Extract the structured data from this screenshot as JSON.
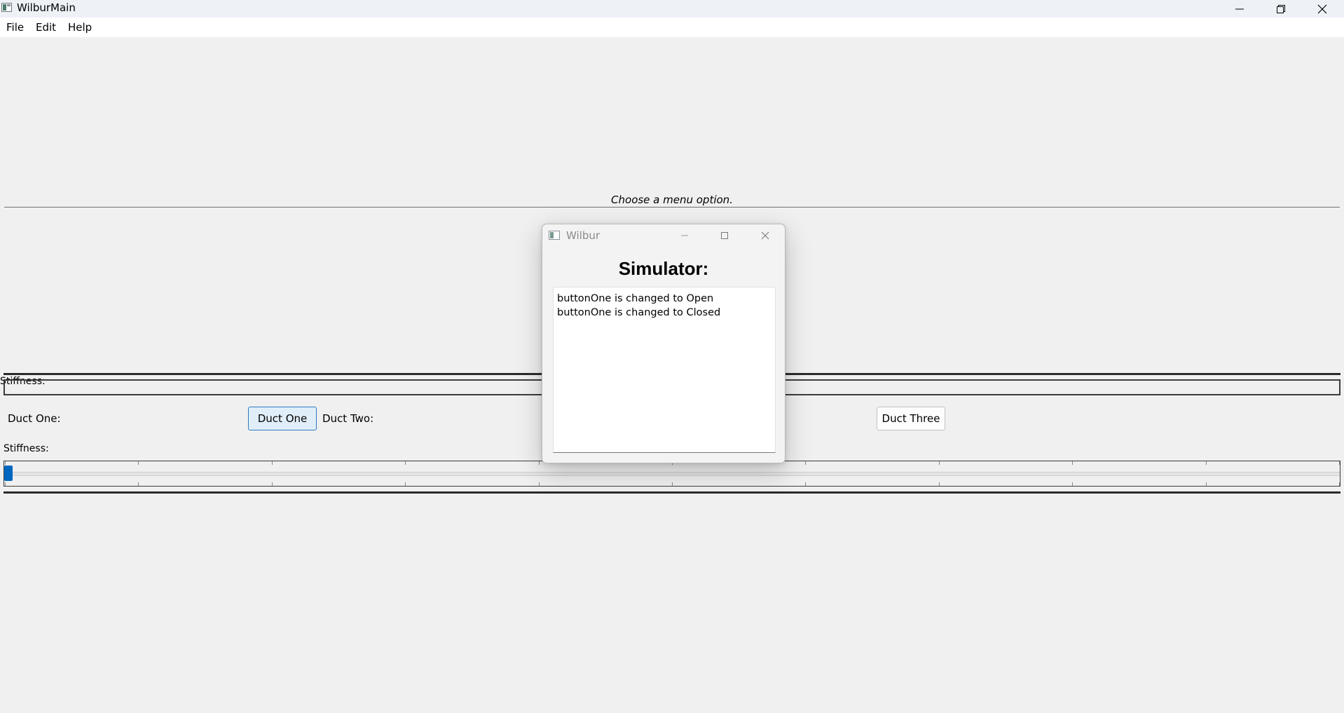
{
  "window": {
    "title": "WilburMain",
    "controls": [
      "minimize",
      "restore",
      "close"
    ]
  },
  "menu": {
    "items": [
      {
        "label": "File"
      },
      {
        "label": "Edit"
      },
      {
        "label": "Help"
      }
    ]
  },
  "main": {
    "status_text": "Choose a menu option.",
    "stiffness_label_top": "Stiffness:",
    "duct_one_label": "Duct One:",
    "duct_one_button": "Duct One",
    "duct_two_label": "Duct Two:",
    "duct_three_button": "Duct Three",
    "stiffness_label_bottom": "Stiffness:",
    "stiffness_slider_value": 0
  },
  "dialog": {
    "title": "Wilbur",
    "heading": "Simulator:",
    "log_lines": [
      "buttonOne is changed to Open",
      "buttonOne is changed to Closed"
    ]
  },
  "colors": {
    "accent": "#0067c0",
    "focused_button_bg": "#e0eef9",
    "background": "#f0f0f0"
  }
}
